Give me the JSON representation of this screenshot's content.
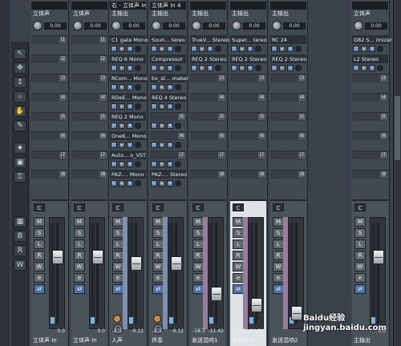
{
  "toolbar": {
    "icons": [
      "arrow-icon",
      "move-icon",
      "resize-icon",
      "zoom-icon",
      "hand-icon",
      "pencil-icon",
      "star-icon",
      "save-icon",
      "key-icon"
    ]
  },
  "left_buttons": [
    "B",
    "R",
    "W"
  ],
  "channels": [
    {
      "top_name": "",
      "output": "立体声",
      "knob_val": "0.00",
      "name": "立体声 In",
      "inserts": [],
      "vals": [
        "",
        "0.0"
      ]
    },
    {
      "top_name": "",
      "output": "立体声",
      "knob_val": "0.00",
      "name": "立体声 In",
      "inserts": [],
      "vals": [
        "",
        "0.0"
      ]
    },
    {
      "top_name": "右 - 立体声 In",
      "output": "主输出",
      "knob_val": "0.00",
      "name": "人声",
      "inserts": [
        "C1 gate Mono",
        "REQ 6 Mono",
        "RCom... Mono",
        "RDeE... Mono",
        "REQ 2 Mono",
        "OneK... Mono",
        "Auto... o_VST",
        "PAZ-... Mono"
      ],
      "vals": [
        "-2.1",
        "-0.12"
      ]
    },
    {
      "top_name": "立体声 In 4",
      "output": "主输出",
      "knob_val": "0.00",
      "name": "伴奏",
      "inserts": [
        "Soun... tereo",
        "Compressor",
        "bx_st... maker",
        "REQ 4 Stereo",
        "",
        "",
        "",
        "PAZ-... Stereo"
      ],
      "vals": [
        "-2.1",
        "-0.12"
      ]
    },
    {
      "top_name": "",
      "output": "主输出",
      "knob_val": "0.00",
      "name": "发送混响1",
      "inserts": [
        "TrueV... Stereo",
        "REQ 2 Stereo"
      ],
      "vals": [
        "-18.3",
        "-11.42"
      ]
    },
    {
      "top_name": "",
      "output": "主输出",
      "knob_val": "0.00",
      "name": "发送延迟",
      "inserts": [
        "Super... tereo",
        "REQ 2 Stereo"
      ],
      "vals": [
        "-21.3",
        "-20.20"
      ]
    },
    {
      "top_name": "",
      "output": "主输出",
      "knob_val": "0.00",
      "name": "发送混响2",
      "inserts": [
        "RC 24",
        "REQ 2 Stereo"
      ],
      "vals": [
        "",
        ""
      ]
    },
    {
      "top_name": "",
      "output": "立体声",
      "knob_val": "0.00",
      "name": "主输出",
      "inserts": [
        "D82 S... imizer",
        "L2 Stereo"
      ],
      "vals": [
        "",
        "0.0"
      ]
    }
  ],
  "strip_labels": {
    "c": "C",
    "m": "M",
    "s": "S",
    "l": "L",
    "r": "R",
    "w": "W",
    "e": "e"
  },
  "slot_numbers": [
    "i1",
    "i2",
    "i3",
    "i4",
    "i5",
    "i6",
    "i7",
    "i8"
  ],
  "watermark": "Baidu经验 jingyan.baidu.com"
}
